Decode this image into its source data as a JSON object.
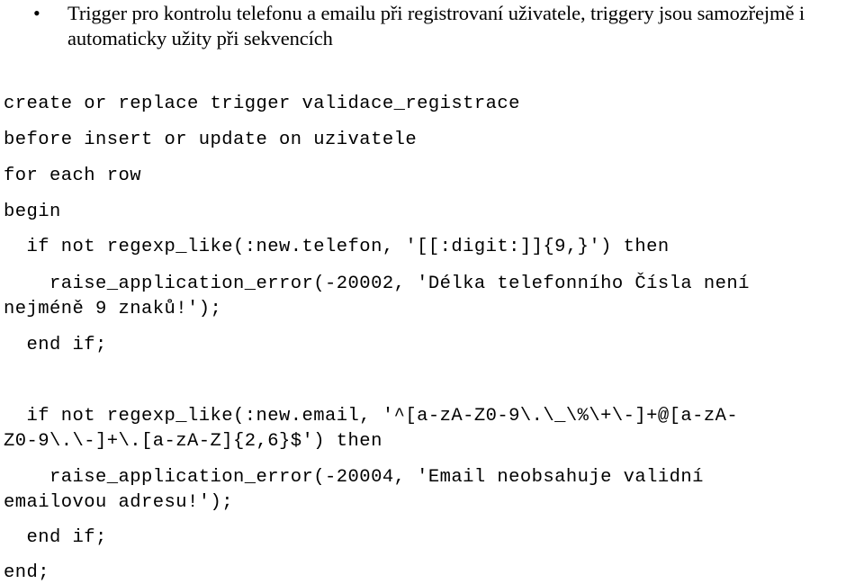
{
  "bullet": {
    "marker": "•",
    "text": "Trigger pro kontrolu telefonu a emailu při registrovaní uživatele, triggery jsou samozřejmě i automaticky užity při sekvencích"
  },
  "code": {
    "lines": [
      "create or replace trigger validace_registrace",
      "before insert or update on uzivatele",
      "for each row",
      "begin",
      "  if not regexp_like(:new.telefon, '[[:digit:]]{9,}') then",
      "    raise_application_error(-20002, 'Délka telefonního Čísla není",
      "nejméně 9 znaků!');",
      "  end if;",
      "  if not regexp_like(:new.email, '^[a-zA-Z0-9\\.\\_\\%\\+\\-]+@[a-zA-",
      "Z0-9\\.\\-]+\\.[a-zA-Z]{2,6}$') then",
      "    raise_application_error(-20004, 'Email neobsahuje validní",
      "emailovou adresu!');",
      "  end if;",
      "end;"
    ]
  }
}
